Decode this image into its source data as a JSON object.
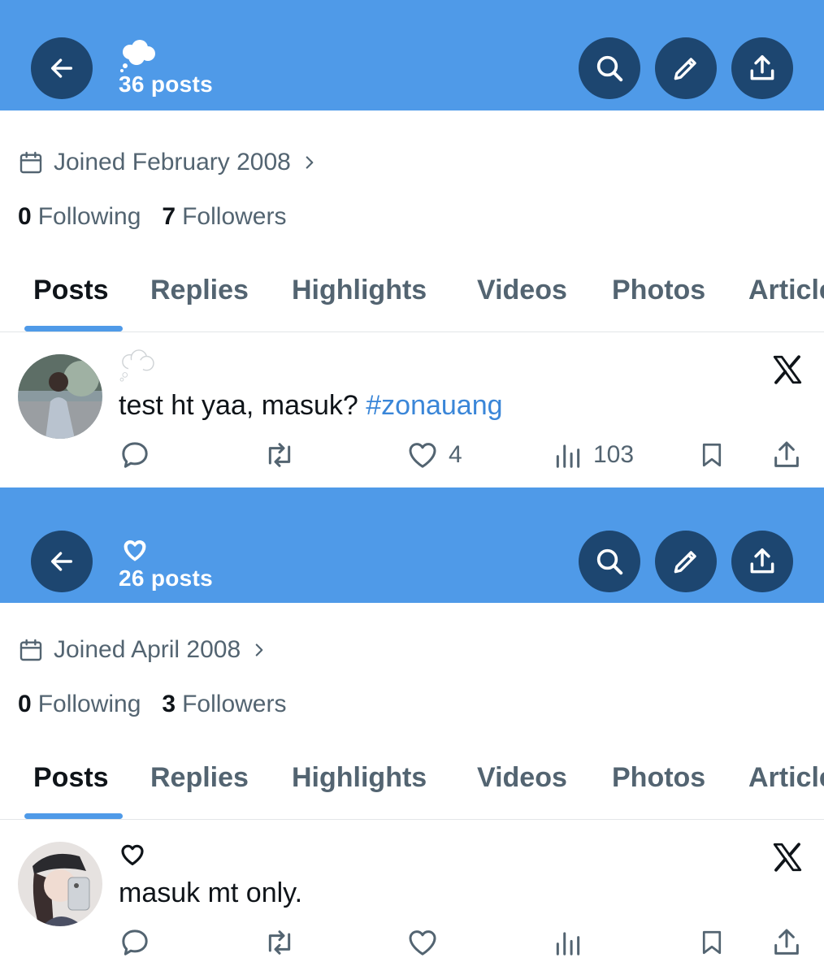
{
  "panels": [
    {
      "header": {
        "emoji": "cloud-emoji",
        "posts_count": "36 posts"
      },
      "joined": "Joined February 2008",
      "following_count": "0",
      "following_label": "Following",
      "followers_count": "7",
      "followers_label": "Followers",
      "tabs": [
        "Posts",
        "Replies",
        "Highlights",
        "Videos",
        "Photos",
        "Articles"
      ],
      "active_tab": "Posts",
      "post": {
        "name_emoji": "cloud-emoji",
        "text": "test ht yaa, masuk?",
        "hashtag": "#zonauang",
        "likes": "4",
        "views": "103"
      }
    },
    {
      "header": {
        "emoji": "white-heart-emoji",
        "posts_count": "26 posts"
      },
      "joined": "Joined April 2008",
      "following_count": "0",
      "following_label": "Following",
      "followers_count": "3",
      "followers_label": "Followers",
      "tabs": [
        "Posts",
        "Replies",
        "Highlights",
        "Videos",
        "Photos",
        "Articles"
      ],
      "active_tab": "Posts",
      "post": {
        "name_emoji": "black-heart-emoji",
        "text": "masuk mt only.",
        "hashtag": "",
        "likes": "",
        "views": ""
      }
    }
  ],
  "colors": {
    "header_bg": "#4f9ae8",
    "button_bg": "#1d4670",
    "hashtag": "#3a86d8",
    "tab_indicator": "#4f9ae8",
    "muted_text": "#536471"
  }
}
